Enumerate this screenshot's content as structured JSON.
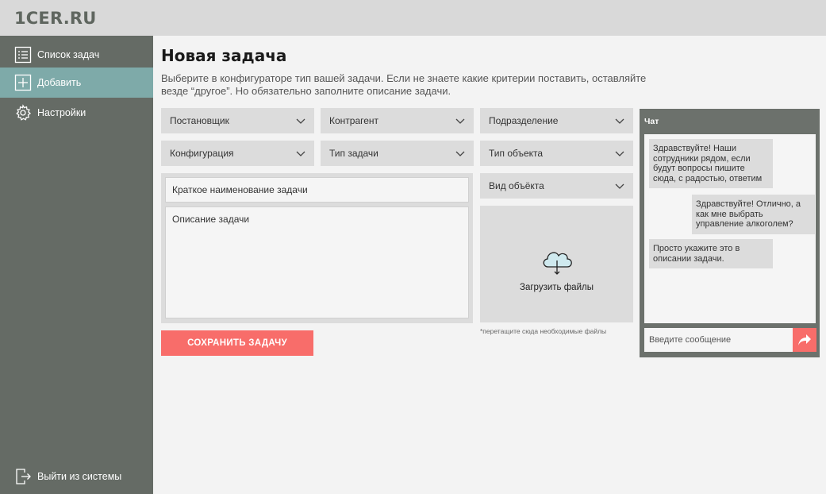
{
  "header": {
    "logo": "1CER.RU"
  },
  "sidebar": {
    "items": [
      {
        "label": "Список задач",
        "icon": "list-icon"
      },
      {
        "label": "Добавить",
        "icon": "plus-icon",
        "active": true
      },
      {
        "label": "Настройки",
        "icon": "gear-icon"
      }
    ],
    "logout": {
      "label": "Выйти из системы",
      "icon": "logout-icon"
    }
  },
  "main": {
    "title": "Новая задача",
    "description": "Выберите в конфигураторе тип вашей задачи. Если не знаете какие критерии поставить, оставляйте везде “другое”. Но обязательно заполните описание задачи.",
    "dropdowns": {
      "postanovshik": "Постановщик",
      "kontragent": "Контрагент",
      "podrazdelenie": "Подразделение",
      "konfiguraciya": "Конфигурация",
      "tip_zadachi": "Тип задачи",
      "tip_obekta": "Тип объекта",
      "vid_obekta": "Вид объёкта"
    },
    "short_name_placeholder": "Краткое наименование задачи",
    "description_placeholder": "Описание задачи",
    "upload": {
      "label": "Загрузить файлы",
      "hint": "*перетащите сюда необходимые файлы"
    },
    "save_label": "СОХРАНИТЬ ЗАДАЧУ"
  },
  "chat": {
    "title": "Чат",
    "messages": [
      {
        "from": "support",
        "text": "Здравствуйте! Наши сотрудники рядом, если будут вопросы пишите сюда, с радостью, ответим"
      },
      {
        "from": "user",
        "text": "Здравствуйте! Отлично, а как мне выбрать управление алкоголем?"
      },
      {
        "from": "support",
        "text": "Просто укажите это в описании задачи."
      }
    ],
    "input_placeholder": "Введите сообщение"
  },
  "colors": {
    "sidebar": "#656b65",
    "active_nav": "#7eaaa9",
    "accent": "#f86d6a",
    "field": "#dcdcdc",
    "upload_cloud": "#cfe9ee"
  }
}
